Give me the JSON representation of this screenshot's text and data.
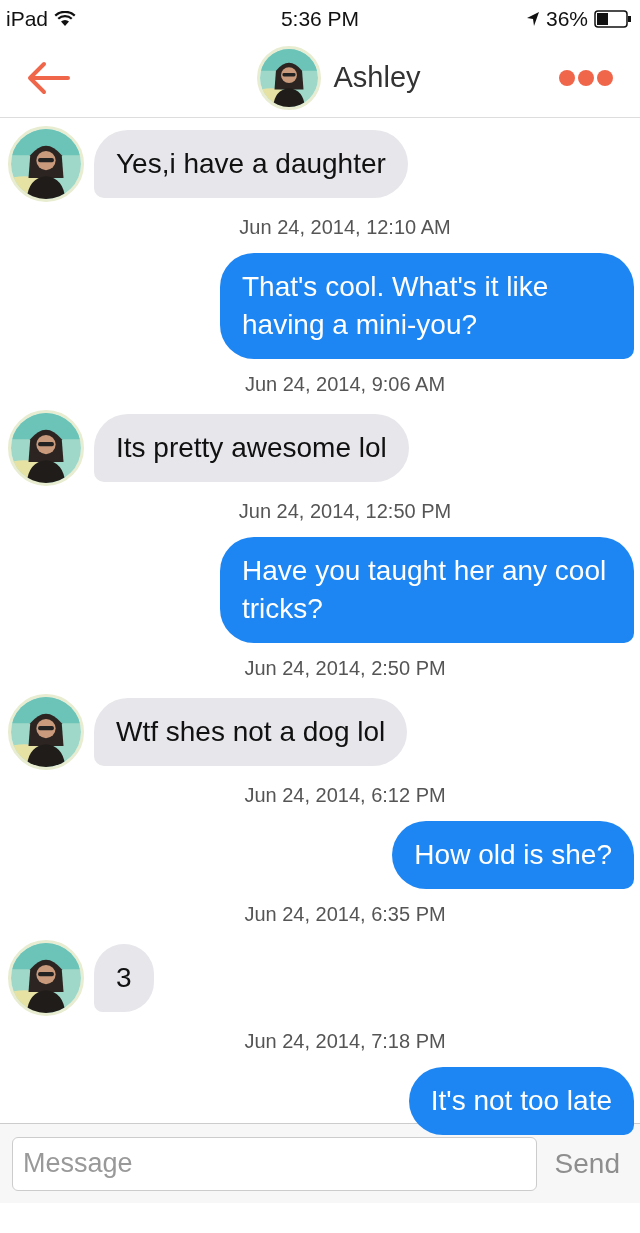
{
  "status_bar": {
    "device": "iPad",
    "time": "5:36 PM",
    "battery": "36%"
  },
  "header": {
    "title": "Ashley"
  },
  "messages": [
    {
      "kind": "incoming",
      "text": "Yes,i have a daughter"
    },
    {
      "kind": "timestamp",
      "text": "Jun 24, 2014, 12:10 AM"
    },
    {
      "kind": "outgoing",
      "text": "That's cool. What's it like having a mini-you?"
    },
    {
      "kind": "timestamp",
      "text": "Jun 24, 2014, 9:06 AM"
    },
    {
      "kind": "incoming",
      "text": "Its pretty awesome lol"
    },
    {
      "kind": "timestamp",
      "text": "Jun 24, 2014, 12:50 PM"
    },
    {
      "kind": "outgoing",
      "text": "Have you taught her any cool tricks?"
    },
    {
      "kind": "timestamp",
      "text": "Jun 24, 2014, 2:50 PM"
    },
    {
      "kind": "incoming",
      "text": "Wtf shes not a dog lol"
    },
    {
      "kind": "timestamp",
      "text": "Jun 24, 2014, 6:12 PM"
    },
    {
      "kind": "outgoing",
      "text": "How old is she?"
    },
    {
      "kind": "timestamp",
      "text": "Jun 24, 2014, 6:35 PM"
    },
    {
      "kind": "incoming",
      "text": "3"
    },
    {
      "kind": "timestamp",
      "text": "Jun 24, 2014, 7:18 PM"
    },
    {
      "kind": "outgoing",
      "text": "It's not too late"
    }
  ],
  "composer": {
    "placeholder": "Message",
    "send": "Send"
  }
}
